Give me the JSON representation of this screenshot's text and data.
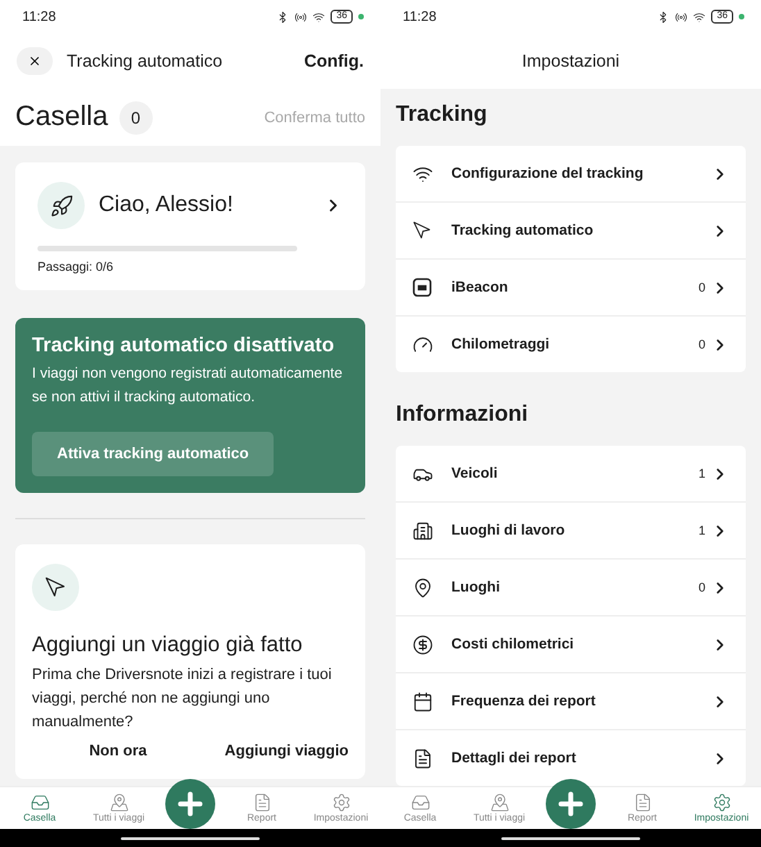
{
  "phones": [
    {
      "status_bar": {
        "time": "11:28",
        "battery": "36"
      },
      "header": {
        "kind": "back",
        "title": "Tracking automatico",
        "action": "Config."
      },
      "screen": {
        "kind": "inbox",
        "title": "Casella",
        "count": "0",
        "confirm": "Conferma tutto",
        "greeting": {
          "text": "Ciao, Alessio!",
          "level": 0,
          "steps": "Passaggi: 0/6"
        },
        "alert": {
          "title": "Tracking automatico disattivato",
          "text": "I viaggi non vengono registrati automaticamente se non attivi il tracking automatico.",
          "button": "Attiva tracking automatico"
        },
        "suggestion": {
          "title": "Aggiungi un viaggio già fatto",
          "text": "Prima che Driversnote inizi a registrare i tuoi viaggi, perché non ne aggiungi uno manualmente?",
          "buttons": [
            "Non ora",
            "Aggiungi viaggio"
          ]
        }
      },
      "nav": [
        {
          "label": "Casella",
          "selected": true
        },
        {
          "label": "Tutti i viaggi",
          "selected": false
        },
        {
          "label": "Report",
          "selected": false
        },
        {
          "label": "Impostazioni",
          "selected": false
        }
      ]
    },
    {
      "status_bar": {
        "time": "11:28",
        "battery": "36"
      },
      "header": {
        "kind": "center",
        "title": "Impostazioni"
      },
      "screen": {
        "kind": "settings",
        "sections": [
          {
            "title": "Tracking",
            "rows": [
              {
                "label": "Configurazione del tracking"
              },
              {
                "label": "Tracking automatico"
              },
              {
                "label": "iBeacon",
                "count": "0"
              },
              {
                "label": "Chilometraggi",
                "count": "0"
              }
            ]
          },
          {
            "title": "Informazioni",
            "rows": [
              {
                "label": "Veicoli",
                "count": "1"
              },
              {
                "label": "Luoghi di lavoro",
                "count": "1"
              },
              {
                "label": "Luoghi",
                "count": "0"
              },
              {
                "label": "Costi chilometrici"
              },
              {
                "label": "Frequenza dei report"
              },
              {
                "label": "Dettagli dei report"
              }
            ]
          }
        ]
      },
      "nav": [
        {
          "label": "Casella",
          "selected": false
        },
        {
          "label": "Tutti i viaggi",
          "selected": false
        },
        {
          "label": "Report",
          "selected": false
        },
        {
          "label": "Impostazioni",
          "selected": true
        }
      ]
    }
  ]
}
